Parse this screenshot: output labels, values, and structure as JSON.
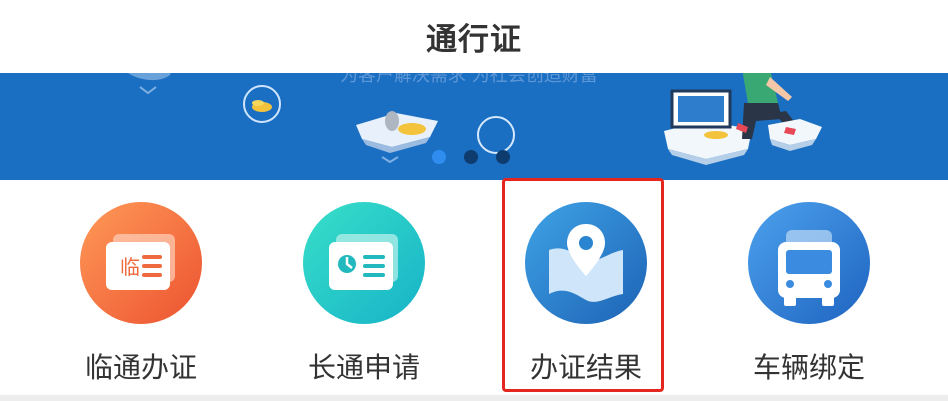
{
  "header": {
    "title": "通行证"
  },
  "banner": {
    "slogan": "为客户解决需求 为社会创造财富",
    "active_slide": 1,
    "slide_count": 3
  },
  "menu": {
    "items": [
      {
        "label": "临通办证",
        "icon": "temporary-pass-card-icon",
        "icon_text": "临"
      },
      {
        "label": "长通申请",
        "icon": "long-term-pass-card-icon"
      },
      {
        "label": "办证结果",
        "icon": "location-map-icon"
      },
      {
        "label": "车辆绑定",
        "icon": "truck-icon"
      }
    ]
  },
  "colors": {
    "banner": "#1b6fc3",
    "highlight_border": "#e5261f",
    "item1": "#f26a3f",
    "item2": "#21c7c1",
    "item3": "#2a84d0",
    "item4": "#2f7ed7"
  }
}
